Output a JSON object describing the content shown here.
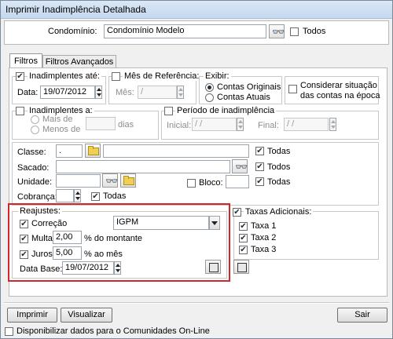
{
  "window": {
    "title": "Imprimir Inadimplência Detalhada"
  },
  "header": {
    "condominio_label": "Condomínio:",
    "condominio_value": "Condomínio Modelo",
    "todos_label": "Todos"
  },
  "tabs": [
    {
      "label": "Filtros"
    },
    {
      "label": "Filtros Avançados"
    }
  ],
  "inadimplentes_ate": {
    "label": "Inadimplentes até:",
    "data_label": "Data:",
    "data_value": "19/07/2012"
  },
  "mes_referencia": {
    "label": "Mês de Referência:",
    "mes_label": "Mês:",
    "mes_value": "  /"
  },
  "exibir": {
    "label": "Exibir:",
    "opt1": "Contas Originais",
    "opt2": "Contas Atuais"
  },
  "considerar": {
    "line1": "Considerar situação",
    "line2": "das contas na época"
  },
  "inadimplentes_a": {
    "label": "Inadimplentes a:",
    "mais_de": "Mais de",
    "menos_de": "Menos de",
    "dias": "dias"
  },
  "periodo": {
    "label": "Período de inadimplência",
    "inicial_label": "Inicial:",
    "inicial_value": "  /  /",
    "final_label": "Final:",
    "final_value": "  /  /"
  },
  "filters": {
    "classe_label": "Classe:",
    "classe_code": ".",
    "sacado_label": "Sacado:",
    "unidade_label": "Unidade:",
    "bloco_label": "Bloco:",
    "cobranca_label": "Cobrança:",
    "todas": "Todas",
    "todos": "Todos"
  },
  "reajustes": {
    "label": "Reajustes:",
    "correcao_label": "Correção",
    "correcao_value": "IGPM",
    "multa_label": "Multa",
    "multa_value": "2,00",
    "multa_suffix": "% do montante",
    "juros_label": "Juros",
    "juros_value": "5,00",
    "juros_suffix": "% ao mês",
    "database_label": "Data Base:",
    "database_value": "19/07/2012"
  },
  "taxas": {
    "label": "Taxas Adicionais:",
    "items": [
      "Taxa 1",
      "Taxa 2",
      "Taxa 3"
    ]
  },
  "buttons": {
    "imprimir": "Imprimir",
    "visualizar": "Visualizar",
    "sair": "Sair"
  },
  "footer": {
    "disponibilizar": "Disponibilizar dados para o Comunidades On-Line"
  },
  "colors": {
    "highlight": "#d3262b",
    "titlebar": "#c5d8ee"
  }
}
